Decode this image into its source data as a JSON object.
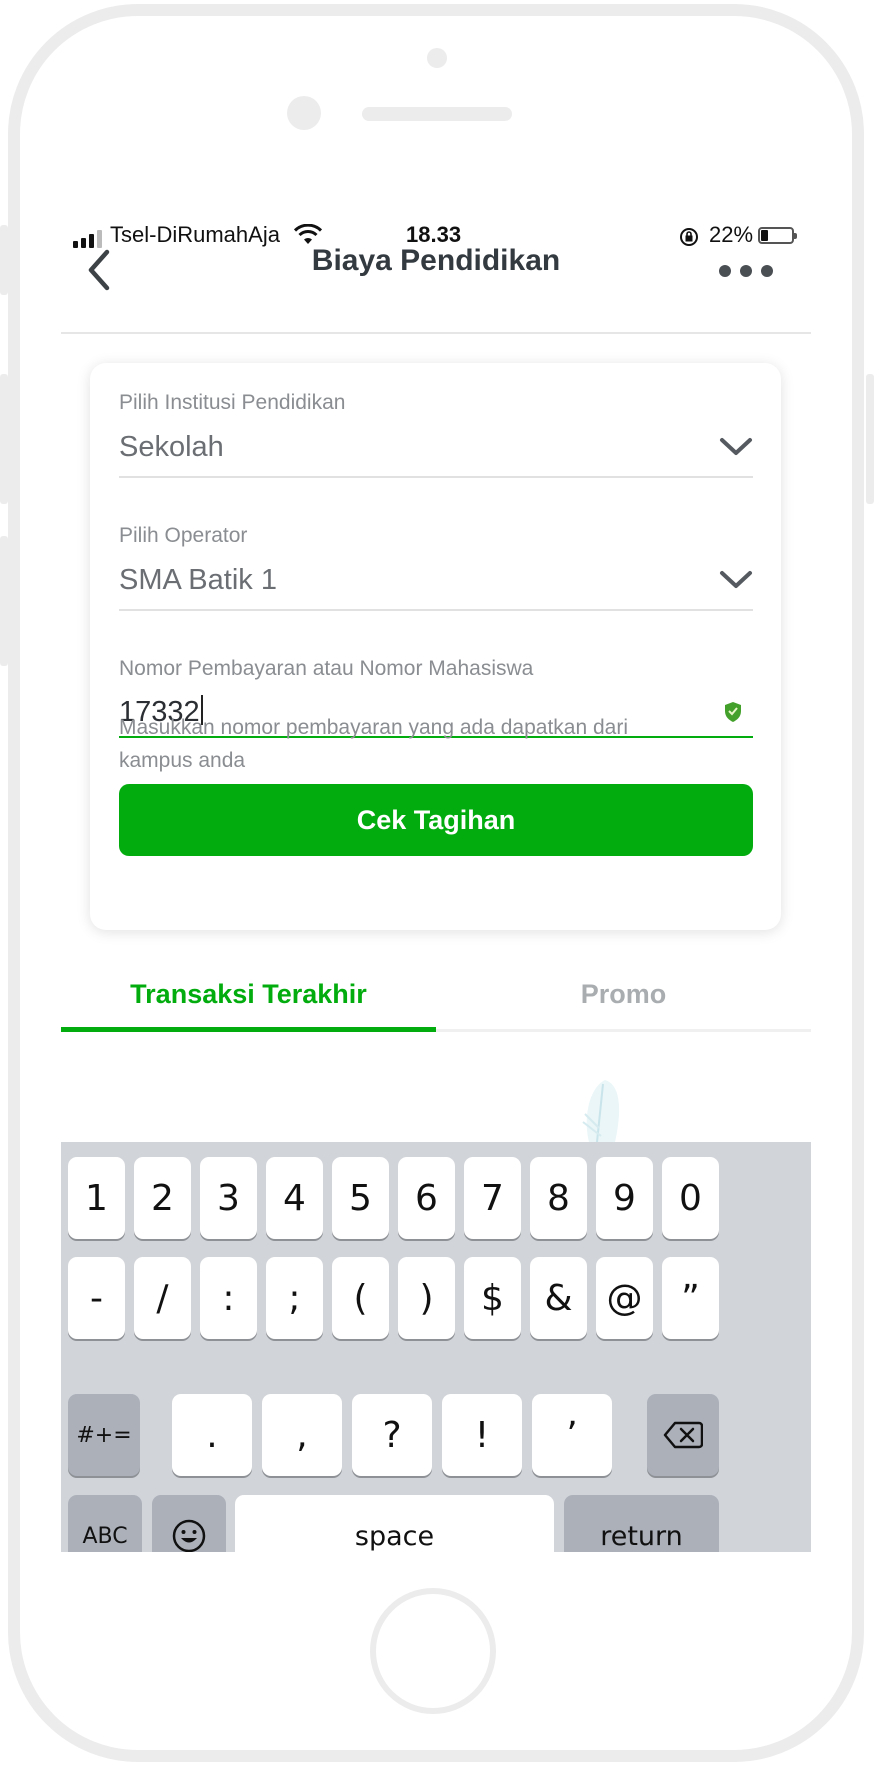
{
  "status_bar": {
    "carrier": "Tsel-DiRumahAja",
    "time": "18.33",
    "battery_pct": "22%",
    "battery_level": 0.22
  },
  "nav": {
    "title": "Biaya Pendidikan",
    "back_icon": "chevron-left-icon",
    "menu_icon": "more-dots-icon"
  },
  "form": {
    "institution": {
      "label": "Pilih Institusi Pendidikan",
      "value": "Sekolah"
    },
    "operator": {
      "label": "Pilih Operator",
      "value": "SMA Batik 1"
    },
    "payment_number": {
      "label": "Nomor Pembayaran atau Nomor Mahasiswa",
      "value": "17332",
      "helper": "Masukkan nomor pembayaran yang ada dapatkan dari kampus anda"
    },
    "submit_label": "Cek Tagihan"
  },
  "tabs": [
    {
      "label": "Transaksi Terakhir",
      "active": true
    },
    {
      "label": "Promo",
      "active": false
    }
  ],
  "keyboard": {
    "row1": [
      "1",
      "2",
      "3",
      "4",
      "5",
      "6",
      "7",
      "8",
      "9",
      "0"
    ],
    "row2": [
      "-",
      "/",
      ":",
      ";",
      "(",
      ")",
      "$",
      "&",
      "@",
      "”"
    ],
    "row3_mode": "#+=",
    "row3": [
      ".",
      ",",
      "?",
      "!",
      "’"
    ],
    "row4_abc": "ABC",
    "row4_space": "space",
    "row4_return": "return"
  },
  "colors": {
    "accent": "#03ac0e",
    "keyboard_bg": "#d1d4d9",
    "key_gray": "#abb0b9"
  }
}
